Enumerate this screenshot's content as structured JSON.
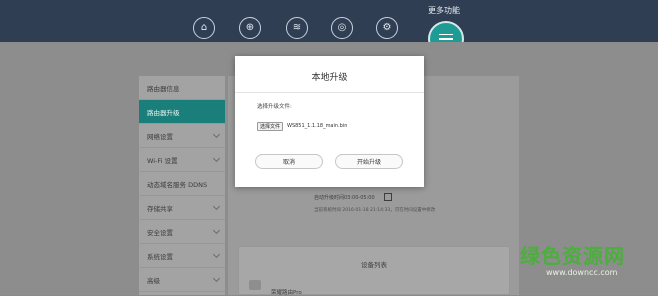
{
  "header": {
    "more_label": "更多功能",
    "nav_icons": [
      {
        "name": "home-icon",
        "glyph": "⌂"
      },
      {
        "name": "globe-icon",
        "glyph": "⊕"
      },
      {
        "name": "wifi-icon",
        "glyph": "≋"
      },
      {
        "name": "internet-icon",
        "glyph": "◎"
      },
      {
        "name": "devices-icon",
        "glyph": "⚙"
      }
    ],
    "accent_color": "#1f9b96",
    "bar_color": "#2f3e52"
  },
  "sidebar": {
    "items": [
      {
        "label": "路由器信息",
        "active": false,
        "expandable": false
      },
      {
        "label": "路由器升级",
        "active": true,
        "expandable": false
      },
      {
        "label": "网络设置",
        "active": false,
        "expandable": true
      },
      {
        "label": "Wi-Fi 设置",
        "active": false,
        "expandable": true
      },
      {
        "label": "动态域名服务 DDNS",
        "active": false,
        "expandable": false
      },
      {
        "label": "存储共享",
        "active": false,
        "expandable": true
      },
      {
        "label": "安全设置",
        "active": false,
        "expandable": true
      },
      {
        "label": "系统设置",
        "active": false,
        "expandable": true
      },
      {
        "label": "高级",
        "active": false,
        "expandable": true
      }
    ]
  },
  "main": {
    "auto_upgrade_label": "自动升级时间03:00-05:00",
    "last_check_note": "当前系统时间 2016-01-18 21:14:33，可在时间设置中修改",
    "device_list_title": "设备列表",
    "device_name": "荣耀路由Pro"
  },
  "modal": {
    "title": "本地升级",
    "select_file_label": "选择升级文件:",
    "choose_file_button": "选择文件",
    "file_name": "WS851_1.1.18_main.bin",
    "cancel_button": "取消",
    "start_button": "开始升级"
  },
  "watermark": {
    "text": "绿色资源网",
    "url": "www.downcc.com"
  }
}
